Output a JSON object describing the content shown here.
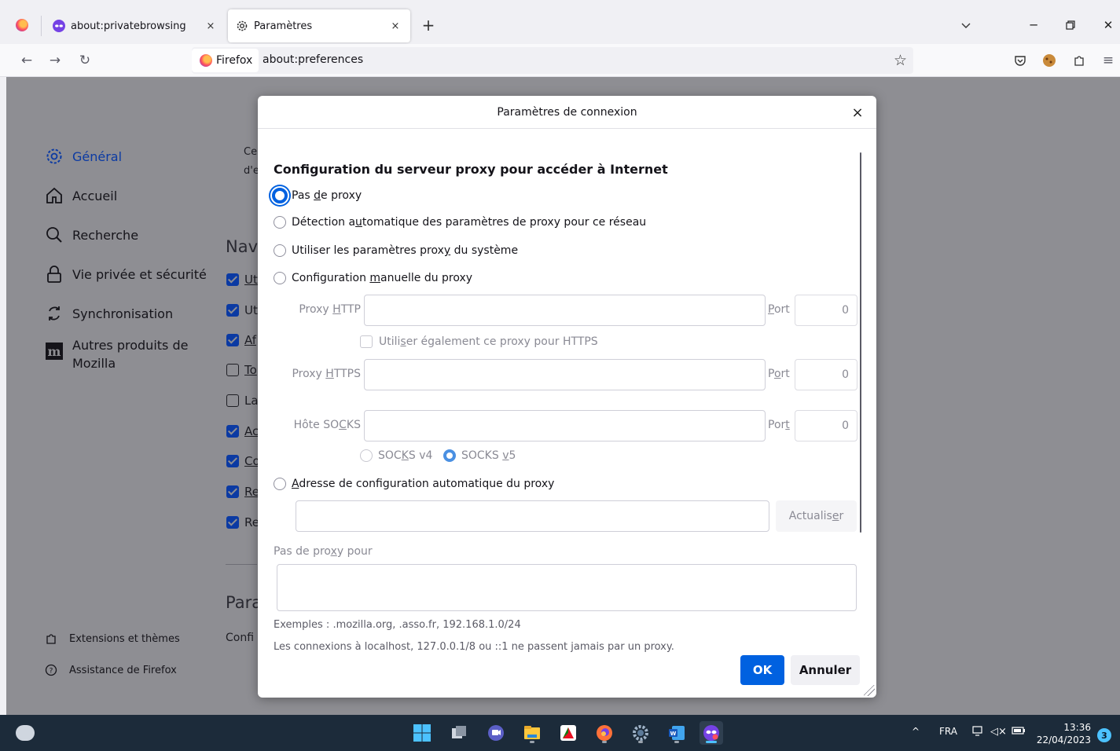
{
  "browser": {
    "tabs": [
      {
        "label": "about:privatebrowsing",
        "close": "×"
      },
      {
        "label": "Paramètres",
        "close": "×"
      }
    ],
    "new_tab": "+",
    "identity_label": "Firefox",
    "url": "about:preferences"
  },
  "sidebar": {
    "items": [
      {
        "label": "Général",
        "icon": "gear-icon"
      },
      {
        "label": "Accueil",
        "icon": "home-icon"
      },
      {
        "label": "Recherche",
        "icon": "search-icon"
      },
      {
        "label": "Vie privée et sécurité",
        "icon": "lock-icon"
      },
      {
        "label": "Synchronisation",
        "icon": "sync-icon"
      },
      {
        "label": "Autres produits de",
        "label2": "Mozilla",
        "icon": "mozilla-icon"
      }
    ],
    "footer": [
      {
        "label": "Extensions et thèmes",
        "icon": "puzzle-icon"
      },
      {
        "label": "Assistance de Firefox",
        "icon": "help-icon"
      }
    ]
  },
  "background_page": {
    "intro_1": "Ce",
    "intro_2": "d'e",
    "nav_heading": "Navi",
    "checkbox_labels": [
      "Ut",
      "Ut",
      "Af",
      "To",
      "La",
      "Ac",
      "Co",
      "Re",
      "Re"
    ],
    "para_heading": "Para",
    "config_text": "Confi"
  },
  "dialog": {
    "title": "Paramètres de connexion",
    "close": "×",
    "section_title": "Configuration du serveur proxy pour accéder à Internet",
    "options": {
      "no_proxy": {
        "pre": "Pas ",
        "key": "d",
        "post": "e proxy"
      },
      "auto_detect": {
        "pre": "Détection a",
        "key": "u",
        "post": "tomatique des paramètres de proxy pour ce réseau"
      },
      "system": {
        "pre": "Utiliser les paramètres prox",
        "key": "y",
        "post": " du système"
      },
      "manual": {
        "pre": "Configuration ",
        "key": "m",
        "post": "anuelle du proxy"
      },
      "auto_url": {
        "pre": "",
        "key": "A",
        "post": "dresse de configuration automatique du proxy"
      }
    },
    "http_label": {
      "pre": "Proxy ",
      "key": "H",
      "post": "TTP"
    },
    "https_label": {
      "pre": "Proxy ",
      "key": "H",
      "post": "TTPS"
    },
    "socks_label": {
      "pre": "Hôte SO",
      "key": "C",
      "post": "KS"
    },
    "port_label_1": {
      "pre": "",
      "key": "P",
      "post": "ort"
    },
    "port_label_2": {
      "pre": "P",
      "key": "o",
      "post": "rt"
    },
    "port_label_3": {
      "pre": "Por",
      "key": "t",
      "post": ""
    },
    "port_values": [
      "0",
      "0",
      "0"
    ],
    "also_https": {
      "pre": "Utili",
      "key": "s",
      "post": "er également ce proxy pour HTTPS"
    },
    "socks_v4": {
      "pre": "SOC",
      "key": "K",
      "post": "S v4"
    },
    "socks_v5": {
      "pre": "SOCKS ",
      "key": "v",
      "post": "5"
    },
    "reload": {
      "pre": "Actualis",
      "key": "e",
      "post": "r"
    },
    "no_proxy_for": {
      "pre": "Pas de pro",
      "key": "x",
      "post": "y pour"
    },
    "examples": "Exemples : .mozilla.org, .asso.fr, 192.168.1.0/24",
    "localhost_note": "Les connexions à localhost, 127.0.0.1/8 ou ::1 ne passent jamais par un proxy.",
    "ok": "OK",
    "cancel": "Annuler"
  },
  "taskbar": {
    "language": "FRA",
    "time": "13:36",
    "date": "22/04/2023",
    "notifications": "3",
    "tray_up": "^"
  },
  "colors": {
    "accent": "#0061e0",
    "overlay": "#8e8e93",
    "taskbar": "#1c2b3a"
  }
}
